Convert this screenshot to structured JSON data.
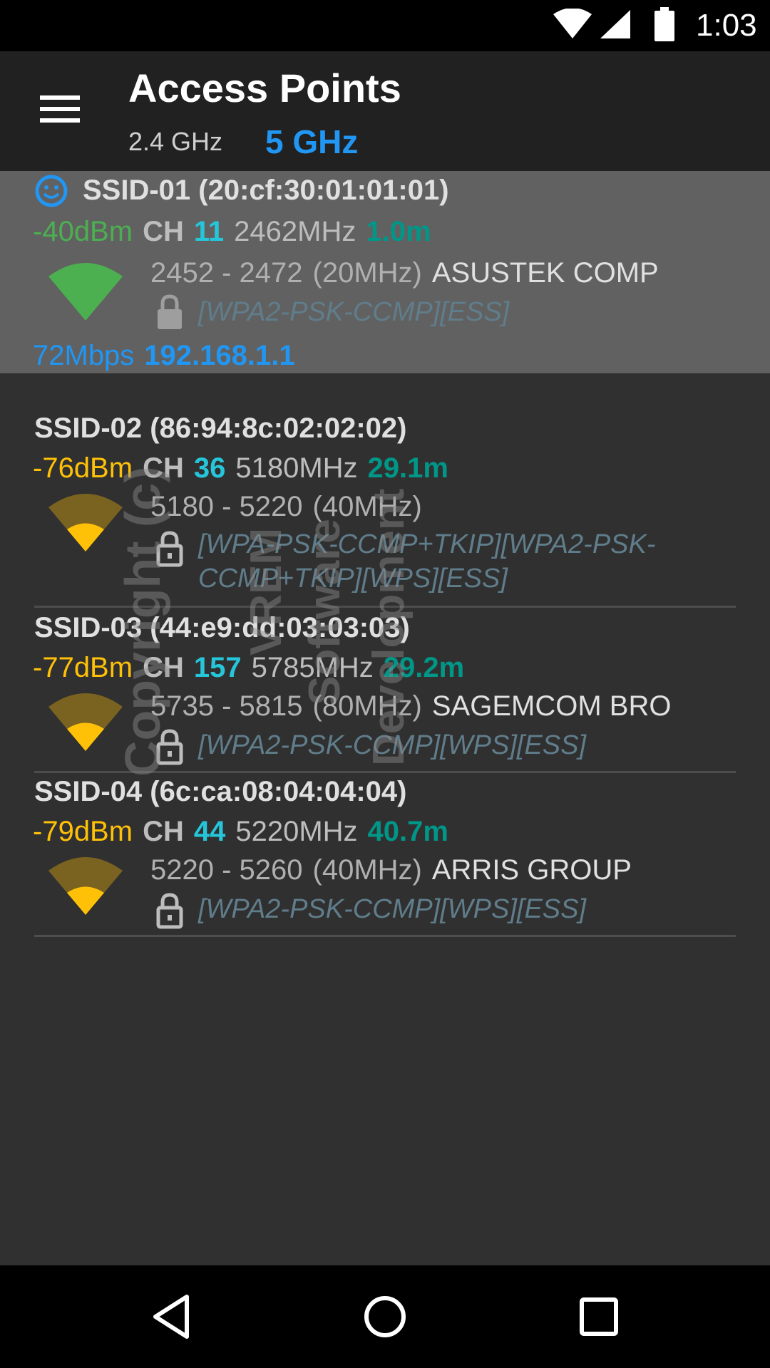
{
  "status_bar": {
    "time": "1:03",
    "icons": [
      "wifi-icon",
      "cell-signal-icon",
      "battery-icon"
    ]
  },
  "app_bar": {
    "title": "Access Points",
    "tabs": [
      {
        "label": "2.4 GHz",
        "selected": false
      },
      {
        "label": "5 GHz",
        "selected": true
      }
    ],
    "menu_icon": "hamburger-menu-icon"
  },
  "access_points": [
    {
      "ssid": "SSID-01 (20:cf:30:01:01:01)",
      "signal": "-40dBm",
      "ch_label": "CH",
      "channel": "11",
      "frequency": "2462MHz",
      "distance": "1.0m",
      "range": "2452 - 2472",
      "width": "(20MHz)",
      "vendor": "ASUSTEK COMP",
      "security": "[WPA2-PSK-CCMP][ESS]",
      "rate": "72Mbps",
      "ip": "192.168.1.1",
      "connected": true,
      "signal_level": 1.0,
      "icon": "connected-smiley-icon"
    },
    {
      "ssid": "SSID-02 (86:94:8c:02:02:02)",
      "signal": "-76dBm",
      "ch_label": "CH",
      "channel": "36",
      "frequency": "5180MHz",
      "distance": "29.1m",
      "range": "5180 - 5220",
      "width": "(40MHz)",
      "vendor": "",
      "security": "[WPA-PSK-CCMP+TKIP][WPA2-PSK-CCMP+TKIP][WPS][ESS]",
      "signal_level": 0.35
    },
    {
      "ssid": "SSID-03 (44:e9:dd:03:03:03)",
      "signal": "-77dBm",
      "ch_label": "CH",
      "channel": "157",
      "frequency": "5785MHz",
      "distance": "29.2m",
      "range": "5735 - 5815",
      "width": "(80MHz)",
      "vendor": "SAGEMCOM BRO",
      "security": "[WPA2-PSK-CCMP][WPS][ESS]",
      "signal_level": 0.35
    },
    {
      "ssid": "SSID-04 (6c:ca:08:04:04:04)",
      "signal": "-79dBm",
      "ch_label": "CH",
      "channel": "44",
      "frequency": "5220MHz",
      "distance": "40.7m",
      "range": "5220 - 5260",
      "width": "(40MHz)",
      "vendor": "ARRIS GROUP",
      "security": "[WPA2-PSK-CCMP][WPS][ESS]",
      "signal_level": 0.35
    }
  ],
  "watermark": {
    "lines": [
      "Copyright (c)",
      "VREM",
      "Software",
      "Development"
    ]
  },
  "colors": {
    "background": "#303030",
    "app_bar": "#212121",
    "selected_row": "#616161",
    "accent_blue": "#2196f3",
    "signal_strong": "#4caf50",
    "signal_weak": "#ffc107",
    "channel": "#26c6da",
    "distance": "#009688",
    "security": "#607d8b"
  },
  "nav_bar": {
    "buttons": [
      "back-icon",
      "home-icon",
      "recents-icon"
    ]
  }
}
